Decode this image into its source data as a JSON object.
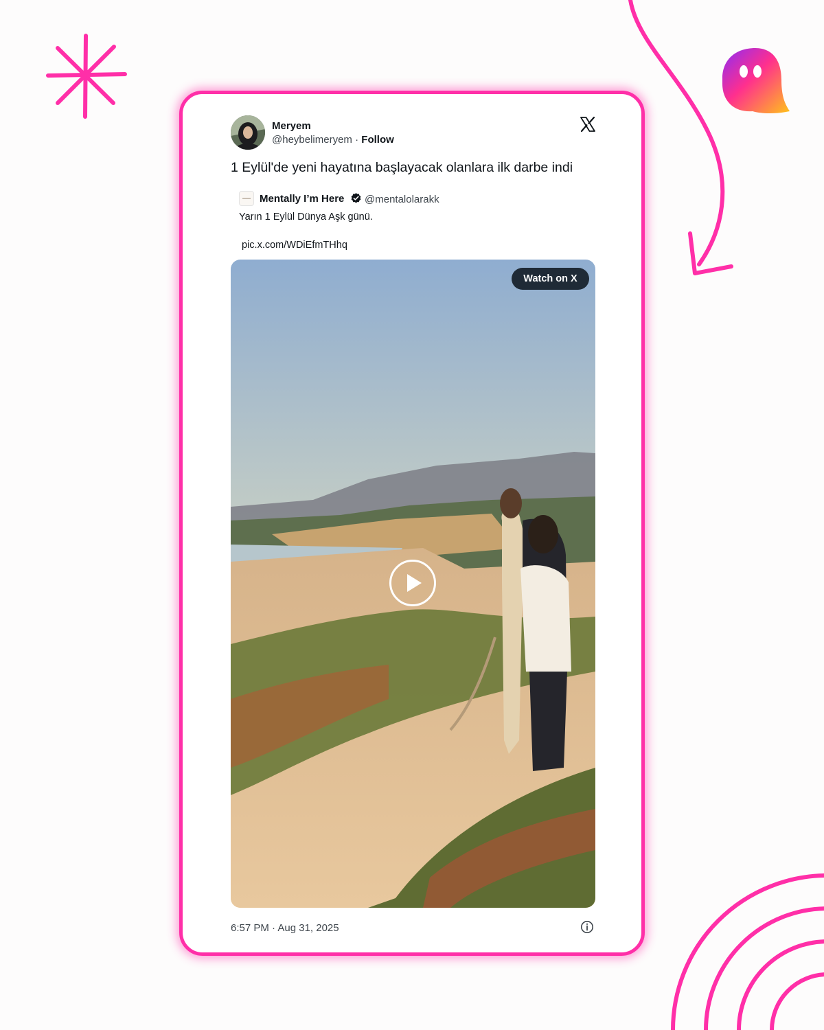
{
  "colors": {
    "accent": "#ff2fa8",
    "text": "#0f1419",
    "muted": "#3e454c",
    "pill": "#1f2a36"
  },
  "decorations": {
    "top_left": "asterisk-doodle",
    "top_right": "ghost-logo",
    "arrow": "curved-arrow",
    "bottom_right": "concentric-arcs"
  },
  "tweet": {
    "author": {
      "name": "Meryem",
      "handle": "@heybelimeryem",
      "separator": "·",
      "follow_label": "Follow"
    },
    "text": "1 Eylül'de yeni hayatına başlayacak olanlara ilk darbe indi",
    "quoted": {
      "name": "Mentally I’m Here",
      "verified": true,
      "handle": "@mentalolarakk",
      "text": "Yarın 1 Eylül Dünya Aşk günü.",
      "link": "pic.x.com/WDiEfmTHhq"
    },
    "media": {
      "type": "video",
      "watch_label": "Watch on X",
      "play_icon": "play-icon"
    },
    "timestamp": "6:57 PM · Aug 31, 2025",
    "icons": {
      "brand": "x-logo-icon",
      "info": "info-icon",
      "verified": "verified-badge-icon"
    }
  }
}
